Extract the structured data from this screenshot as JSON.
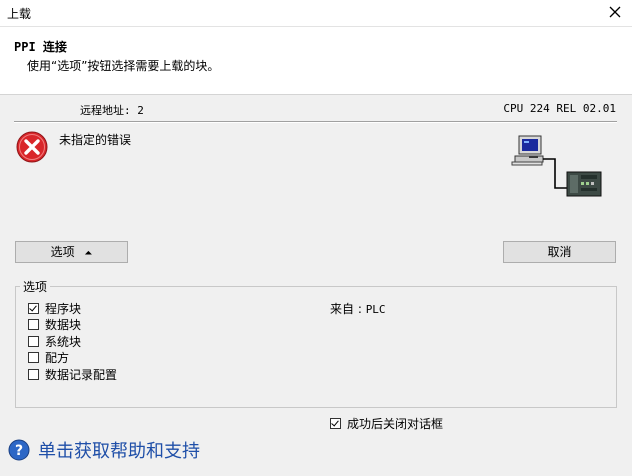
{
  "window": {
    "title": "上载"
  },
  "header": {
    "title": "PPI 连接",
    "subtitle": "使用“选项”按钮选择需要上载的块。"
  },
  "status": {
    "remote_address": "远程地址: 2",
    "cpu_info": "CPU 224 REL 02.01"
  },
  "error": {
    "message": "未指定的错误"
  },
  "buttons": {
    "options_label": "选项",
    "options_arrow": "⏶",
    "cancel_label": "取消"
  },
  "options_group": {
    "legend": "选项",
    "items": [
      {
        "label": "程序块",
        "checked": true
      },
      {
        "label": "数据块",
        "checked": false
      },
      {
        "label": "系统块",
        "checked": false
      },
      {
        "label": "配方",
        "checked": false
      },
      {
        "label": "数据记录配置",
        "checked": false
      }
    ],
    "source_label": "来自 :",
    "source_value": "PLC"
  },
  "footer": {
    "close_after_success_label": "成功后关闭对话框",
    "close_after_success_checked": true,
    "help_text": "单击获取帮助和支持"
  },
  "colors": {
    "error_red": "#d9262a",
    "help_blue": "#1f4fa8"
  }
}
